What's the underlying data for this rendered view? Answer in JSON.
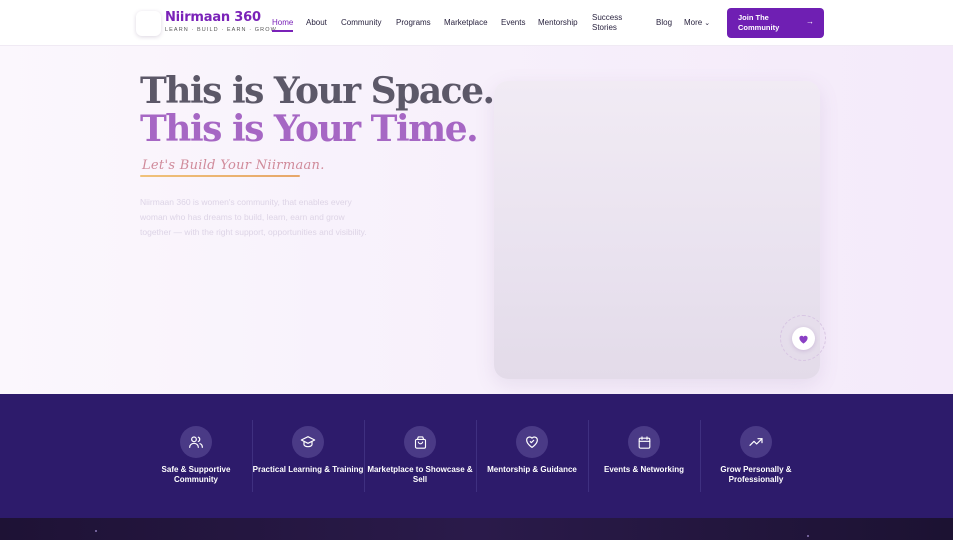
{
  "brand": {
    "name": "Niirmaan 360",
    "tagline": "LEARN · BUILD · EARN · GROW"
  },
  "nav": {
    "items": [
      {
        "label": "Home",
        "active": true
      },
      {
        "label": "About"
      },
      {
        "label": "Community"
      },
      {
        "label": "Programs"
      },
      {
        "label": "Marketplace"
      },
      {
        "label": "Events"
      },
      {
        "label": "Mentorship"
      },
      {
        "label": "Success Stories"
      },
      {
        "label": "Blog"
      },
      {
        "label": "More"
      }
    ],
    "cta": "Join The Community"
  },
  "hero": {
    "title_line1": "This is Your Space.",
    "title_line2": "This is Your Time.",
    "script": "Let's Build Your Niirmaan.",
    "description": "Niirmaan 360 is women's community, that enables every woman who has dreams to build, learn, earn and grow together — with the right support, opportunities and visibility."
  },
  "features": [
    {
      "icon": "users-icon",
      "label": "Safe & Supportive Community"
    },
    {
      "icon": "graduation-cap-icon",
      "label": "Practical Learning & Training"
    },
    {
      "icon": "shopping-bag-icon",
      "label": "Marketplace to Showcase & Sell"
    },
    {
      "icon": "heart-handshake-icon",
      "label": "Mentorship & Guidance"
    },
    {
      "icon": "calendar-icon",
      "label": "Events & Networking"
    },
    {
      "icon": "trending-up-icon",
      "label": "Grow Personally & Professionally"
    }
  ],
  "colors": {
    "brand": "#7a22b8",
    "cta": "#6f1fb3",
    "band": "#2d1b6b",
    "title_gray": "#5c5868",
    "title_purple": "#a667c4"
  }
}
